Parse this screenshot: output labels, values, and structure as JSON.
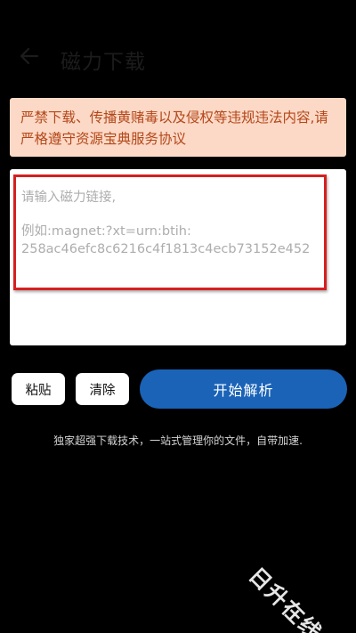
{
  "header": {
    "back_icon": "arrow-left-icon",
    "title": "磁力下载"
  },
  "warning": {
    "text_line1": "严禁下载、传播黄赌毒以及侵权等违规违法内容,请",
    "text_line2": "严格遵守资源宝典服务协议",
    "background": "#fbd9c6",
    "color": "#b4471a"
  },
  "magnet_input": {
    "value": "",
    "placeholder_line1": "请输入磁力链接,",
    "placeholder_line2": "例如:magnet:?xt=urn:btih:",
    "placeholder_line3": "258ac46efc8c6216c4f1813c4ecb73152e452"
  },
  "actions": {
    "paste_label": "粘贴",
    "clear_label": "清除",
    "start_label": "开始解析",
    "accent": "#1a63b7"
  },
  "tagline": "独家超强下载技术，一站式管理你的文件，自带加速.",
  "watermark": "日升在线",
  "highlight_color": "#d61f1f"
}
